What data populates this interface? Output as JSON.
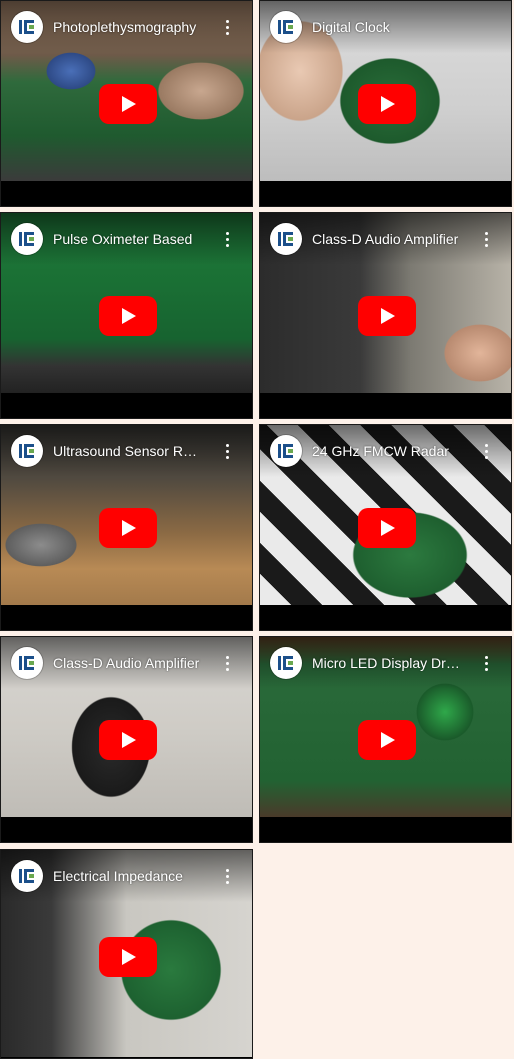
{
  "videos": [
    {
      "title": "Photoplethysmography"
    },
    {
      "title": "Digital Clock"
    },
    {
      "title": "Pulse Oximeter Based"
    },
    {
      "title": "Class-D Audio Amplifier"
    },
    {
      "title": "Ultrasound Sensor Range"
    },
    {
      "title": "24 GHz FMCW Radar"
    },
    {
      "title": "Class-D Audio Amplifier"
    },
    {
      "title": "Micro LED Display Driver"
    },
    {
      "title": "Electrical Impedance"
    }
  ],
  "colors": {
    "page_background": "#fdf1e9",
    "play_button": "#ff0000",
    "title_text": "#ffffff"
  },
  "icons": {
    "channel_logo": "channel-logo-icon",
    "play": "youtube-play-icon",
    "more": "more-vertical-icon"
  }
}
